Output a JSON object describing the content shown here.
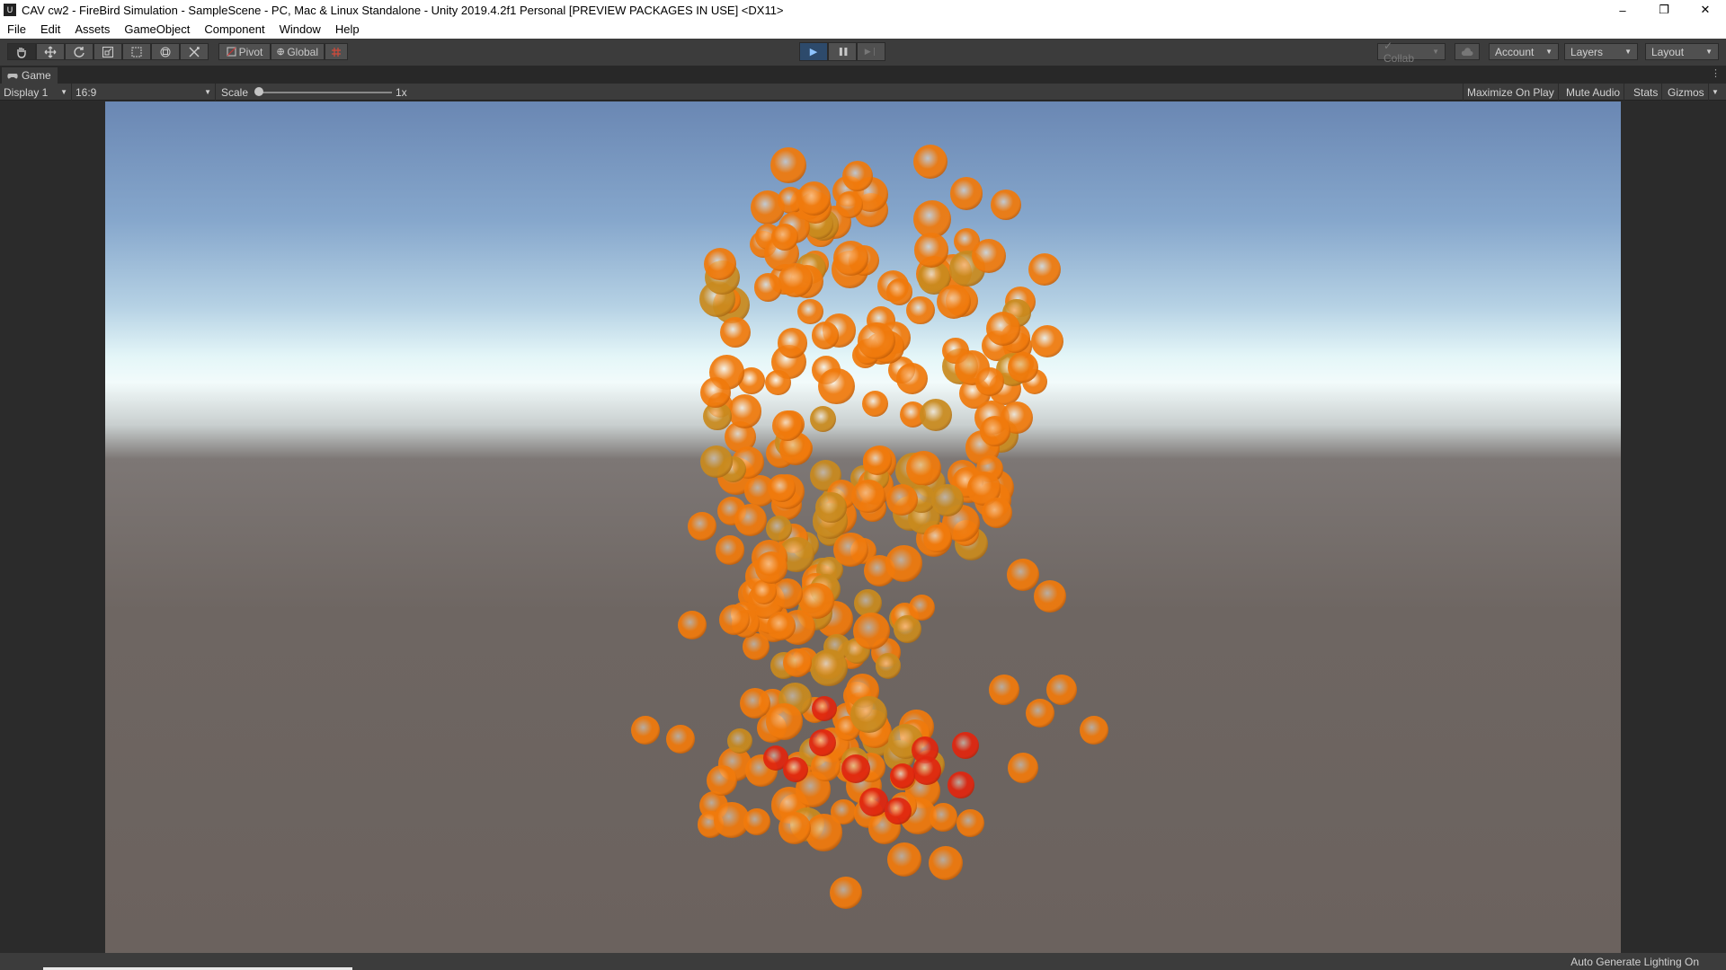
{
  "window": {
    "icon_label": "U",
    "title": "CAV cw2 - FireBird Simulation - SampleScene - PC, Mac & Linux Standalone - Unity 2019.4.2f1 Personal [PREVIEW PACKAGES IN USE] <DX11>",
    "minimize": "–",
    "restore": "❐",
    "close": "✕"
  },
  "menu": [
    "File",
    "Edit",
    "Assets",
    "GameObject",
    "Component",
    "Window",
    "Help"
  ],
  "toolbar": {
    "tools": [
      "hand-tool-icon",
      "move-tool-icon",
      "rotate-tool-icon",
      "scale-tool-icon",
      "rect-tool-icon",
      "transform-tool-icon",
      "custom-tool-icon"
    ],
    "pivot_label": "Pivot",
    "global_label": "Global",
    "play_icon": "▶",
    "pause_icon": "❚❚",
    "step_icon": "▶❘",
    "collab_label": "Collab",
    "account_label": "Account",
    "layers_label": "Layers",
    "layout_label": "Layout"
  },
  "game_tab": {
    "label": "Game",
    "menu_icon": "⋮"
  },
  "game_bar": {
    "display": "Display 1",
    "aspect": "16:9",
    "scale_label": "Scale",
    "scale_value": "1x",
    "scale_level": 0,
    "maximize": "Maximize On Play",
    "mute": "Mute Audio",
    "stats": "Stats",
    "gizmos": "Gizmos"
  },
  "colors": {
    "accent_play": "#8ec4ff",
    "ball_orange": "#f07a0c",
    "ball_red": "#e0260f",
    "ball_amber": "#c98a1e"
  },
  "status": {
    "text": "Auto Generate Lighting On"
  }
}
